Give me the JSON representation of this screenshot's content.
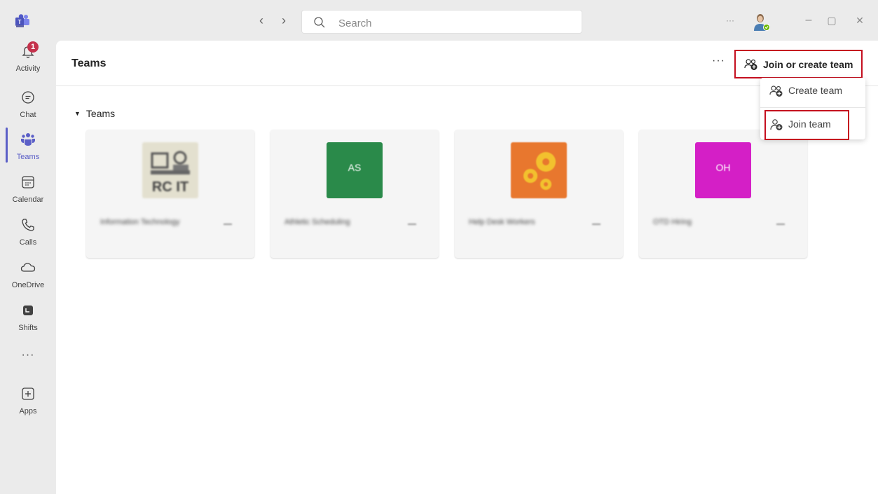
{
  "titlebar": {
    "search_placeholder": "Search",
    "back_glyph": "‹",
    "forward_glyph": "›",
    "more_glyph": "···",
    "minimize_glyph": "–",
    "maximize_glyph": "▢",
    "close_glyph": "✕"
  },
  "rail": {
    "items": [
      {
        "label": "Activity",
        "icon": "bell-icon",
        "badge": "1"
      },
      {
        "label": "Chat",
        "icon": "chat-icon"
      },
      {
        "label": "Teams",
        "icon": "teams-icon",
        "active": true
      },
      {
        "label": "Calendar",
        "icon": "calendar-icon"
      },
      {
        "label": "Calls",
        "icon": "phone-icon"
      },
      {
        "label": "OneDrive",
        "icon": "cloud-icon"
      },
      {
        "label": "Shifts",
        "icon": "shifts-icon"
      },
      {
        "label": "Apps",
        "icon": "add-app-icon"
      }
    ],
    "more_glyph": "···"
  },
  "header": {
    "title": "Teams",
    "more_glyph": "···",
    "join_create_label": "Join or create team"
  },
  "section": {
    "label": "Teams"
  },
  "teams": [
    {
      "name": "Information Technology",
      "initials": "",
      "color": "#e3e0cf"
    },
    {
      "name": "Athletic Scheduling",
      "initials": "AS",
      "color": "#2a8a4a"
    },
    {
      "name": "Help Desk Workers",
      "initials": "",
      "color": "#e8772e"
    },
    {
      "name": "OTD Hiring",
      "initials": "OH",
      "color": "#d41fc6"
    }
  ],
  "dropdown": {
    "create_label": "Create team",
    "join_label": "Join team"
  },
  "colors": {
    "accent": "#5b5fc7",
    "highlight": "#c50f1f",
    "badge": "#c4314b"
  }
}
